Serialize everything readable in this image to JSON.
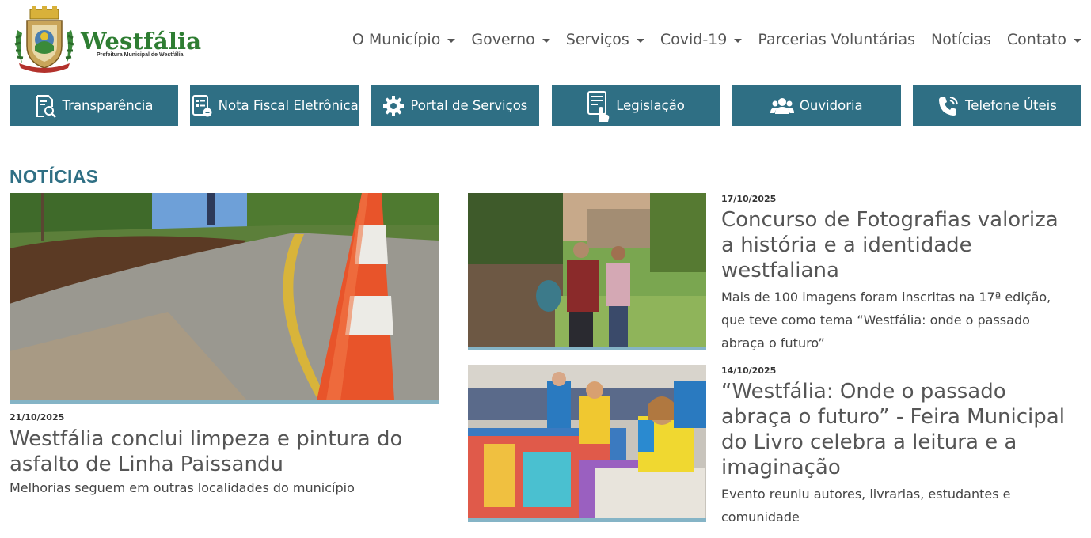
{
  "logo": {
    "name": "Westfália",
    "subtitle": "Prefeitura Municipal de Westfália"
  },
  "nav": {
    "items": [
      {
        "label": "O Município",
        "dropdown": true
      },
      {
        "label": "Governo",
        "dropdown": true
      },
      {
        "label": "Serviços",
        "dropdown": true
      },
      {
        "label": "Covid-19",
        "dropdown": true
      },
      {
        "label": "Parcerias Voluntárias",
        "dropdown": false
      },
      {
        "label": "Notícias",
        "dropdown": false
      },
      {
        "label": "Contato",
        "dropdown": true
      }
    ]
  },
  "quick_links": [
    {
      "label": "Transparência",
      "icon": "document-search-icon"
    },
    {
      "label": "Nota Fiscal Eletrônica",
      "icon": "invoice-icon"
    },
    {
      "label": "Portal de Serviços",
      "icon": "gear-icon"
    },
    {
      "label": "Legislação",
      "icon": "touch-document-icon"
    },
    {
      "label": "Ouvidoria",
      "icon": "users-icon"
    },
    {
      "label": "Telefone Úteis",
      "icon": "phone-icon"
    }
  ],
  "colors": {
    "accent": "#2f6f84",
    "image_border": "#85b4c6",
    "brand_green": "#2e7d32"
  },
  "news": {
    "section_title": "NOTÍCIAS",
    "featured": {
      "date": "21/10/2025",
      "title": "Westfália conclui limpeza e pintura do asfalto de Linha Paissandu",
      "subtitle": "Melhorias seguem em outras localidades do município"
    },
    "items": [
      {
        "date": "17/10/2025",
        "title": "Concurso de Fotografias valoriza a história e a identidade westfaliana",
        "subtitle": "Mais de 100 imagens foram inscritas na 17ª edição, que teve como tema “Westfália: onde o passado abraça o futuro”"
      },
      {
        "date": "14/10/2025",
        "title": "“Westfália: Onde o passado abraça o futuro” - Feira Municipal do Livro celebra a leitura e a imaginação",
        "subtitle": "Evento reuniu autores, livrarias, estudantes e comunidade"
      }
    ]
  }
}
